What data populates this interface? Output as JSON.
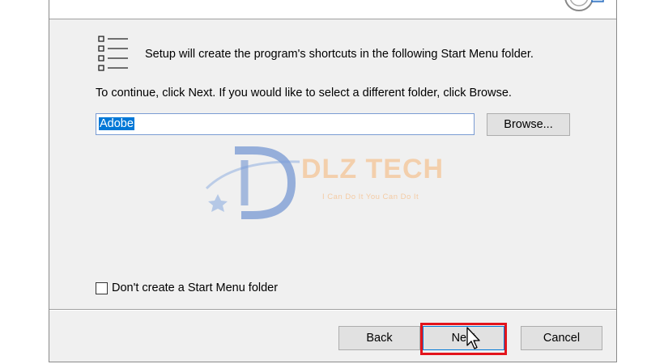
{
  "dialog": {
    "intro_text": "Setup will create the program's shortcuts in the following Start Menu folder.",
    "continue_text": "To continue, click Next. If you would like to select a different folder, click Browse.",
    "folder_value": "Adobe",
    "browse_label": "Browse...",
    "checkbox_label": "Don't create a Start Menu folder",
    "checkbox_checked": false,
    "back_label": "Back",
    "next_label": "Next",
    "cancel_label": "Cancel"
  },
  "watermark": {
    "brand": "DLZ TECH",
    "slogan": "I Can Do It You Can Do It"
  },
  "colors": {
    "selection": "#0078d7",
    "highlight": "#e3141c",
    "watermark_orange": "#f4c496",
    "watermark_blue": "#4a78c8"
  }
}
